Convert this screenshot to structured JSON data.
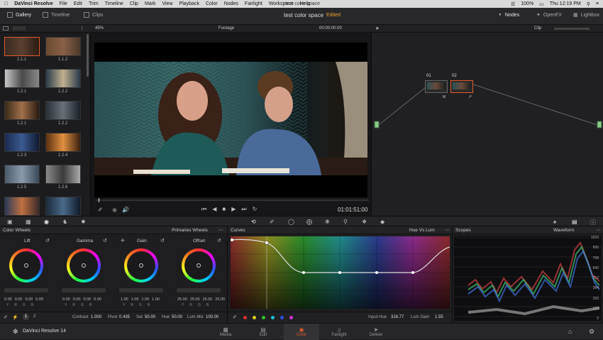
{
  "menubar": {
    "app": "DaVinci Resolve",
    "items": [
      "File",
      "Edit",
      "Trim",
      "Timeline",
      "Clip",
      "Mark",
      "View",
      "Playback",
      "Color",
      "Nodes",
      "Fairlight",
      "Workspace",
      "Help"
    ],
    "center_title": "test color space",
    "battery": "100%",
    "clock": "Thu 12:19 PM"
  },
  "toolbar": {
    "gallery": "Gallery",
    "timeline": "Timeline",
    "clips": "Clips",
    "project": "test color space",
    "status": "Edited",
    "nodes": "Nodes",
    "openfx": "OpenFX",
    "lightbox": "Lightbox"
  },
  "viewer": {
    "zoom": "45%",
    "mode": "Footage",
    "timecode_top": "00:00:00:00",
    "timecode": "01:01:51:00"
  },
  "nodes": {
    "clip_mode": "Clip",
    "node1": "01",
    "node2": "02",
    "node1_badge": "M"
  },
  "gallery": {
    "stills": [
      "1.1.1",
      "1.1.2",
      "1.2.1",
      "1.2.2",
      "1.2.1",
      "1.2.2",
      "1.2.3",
      "1.2.4",
      "1.2.5",
      "1.2.6"
    ]
  },
  "wheels": {
    "title": "Color Wheels",
    "mode": "Primaries Wheels",
    "lift": {
      "label": "Lift",
      "values": [
        "0.00",
        "0.00",
        "0.00",
        "0.00"
      ]
    },
    "gamma": {
      "label": "Gamma",
      "values": [
        "0.00",
        "0.00",
        "0.00",
        "0.00"
      ]
    },
    "gain": {
      "label": "Gain",
      "values": [
        "1.00",
        "1.00",
        "1.00",
        "1.00"
      ]
    },
    "offset": {
      "label": "Offset",
      "values": [
        "25.00",
        "25.00",
        "25.00",
        "25.00"
      ]
    },
    "channels": [
      "Y",
      "R",
      "G",
      "B"
    ],
    "contrast_label": "Contrast",
    "contrast": "1.000",
    "pivot_label": "Pivot",
    "pivot": "0.435",
    "sat_label": "Sat",
    "sat": "50.00",
    "hue_label": "Hue",
    "hue": "50.00",
    "lummix_label": "Lum Mix",
    "lummix": "100.00",
    "page1": "1",
    "page2": "2"
  },
  "curves": {
    "title": "Curves",
    "mode": "Hue Vs Lum",
    "input_hue_label": "Input Hue",
    "input_hue": "316.77",
    "lum_gain_label": "Lum Gain",
    "lum_gain": "1.55",
    "dot_colors": [
      "#e03030",
      "#e0d020",
      "#30c030",
      "#20c0d0",
      "#3050e0",
      "#d030d0"
    ]
  },
  "scopes": {
    "title": "Scopes",
    "mode": "Waveform",
    "scale": [
      "1023",
      "896",
      "768",
      "640",
      "512",
      "384",
      "256",
      "128",
      "0"
    ]
  },
  "pages": {
    "media": "Media",
    "edit": "Edit",
    "color": "Color",
    "fairlight": "Fairlight",
    "deliver": "Deliver"
  },
  "brand": "DaVinci Resolve 14"
}
